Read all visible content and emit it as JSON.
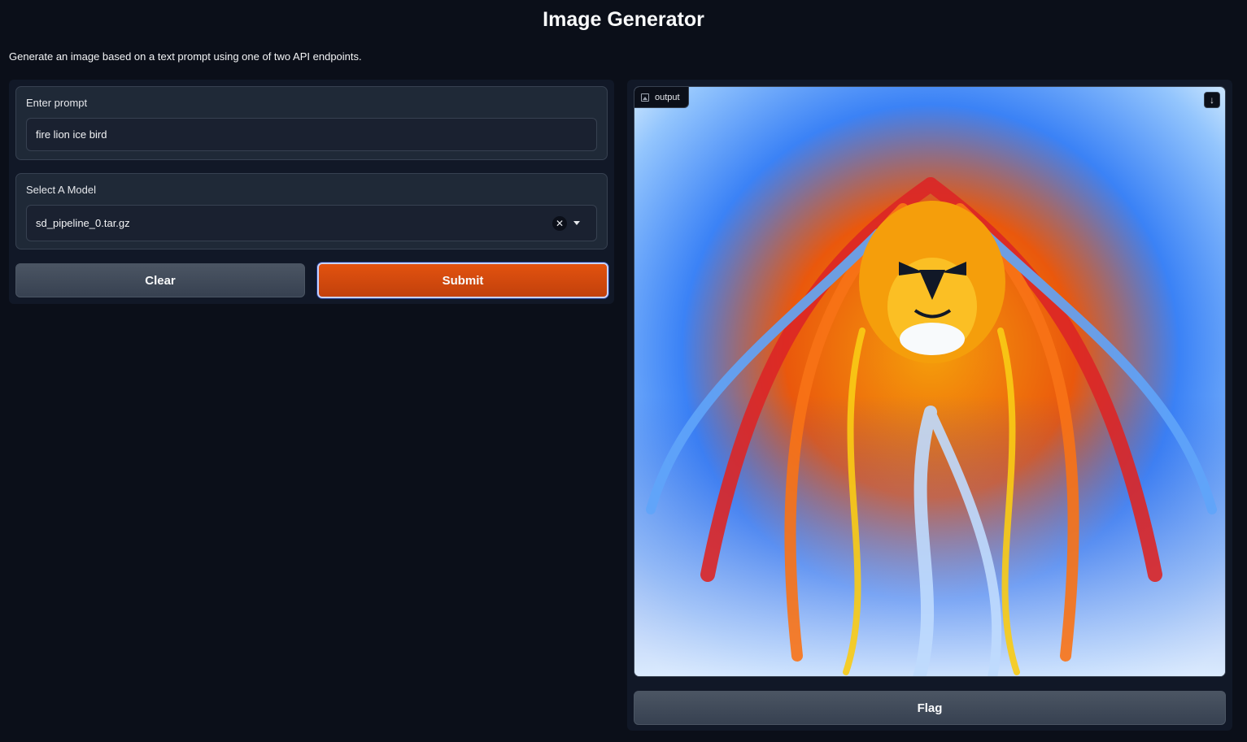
{
  "header": {
    "title": "Image Generator",
    "description": "Generate an image based on a text prompt using one of two API endpoints."
  },
  "prompt": {
    "label": "Enter prompt",
    "value": "fire lion ice bird"
  },
  "model": {
    "label": "Select A Model",
    "selected": "sd_pipeline_0.tar.gz"
  },
  "buttons": {
    "clear": "Clear",
    "submit": "Submit",
    "flag": "Flag"
  },
  "output": {
    "label": "output"
  },
  "colors": {
    "background": "#0b0f19",
    "panel": "#111827",
    "block": "#1f2937",
    "primary": "#c2410c"
  },
  "icons": {
    "output_label": "image-icon",
    "download": "download-icon",
    "dropdown_clear": "close-icon",
    "dropdown_toggle": "chevron-down-icon"
  }
}
